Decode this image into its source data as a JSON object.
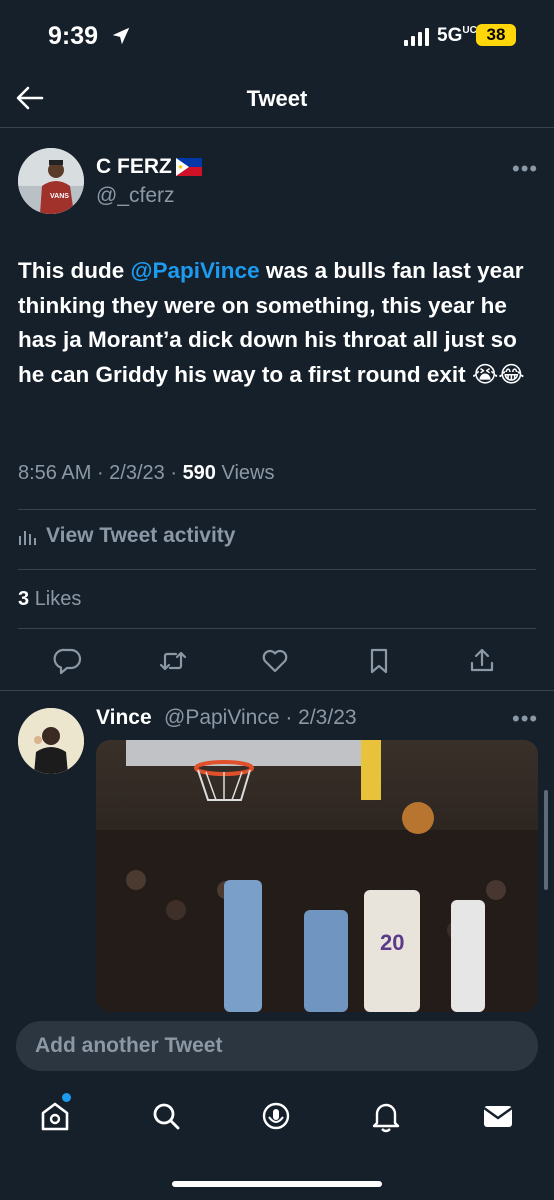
{
  "status_bar": {
    "time": "9:39",
    "network": "5G",
    "network_sup": "UC",
    "battery": "38"
  },
  "header": {
    "title": "Tweet"
  },
  "tweet": {
    "author_name": "C FERZ",
    "author_handle": "@_cferz",
    "text_before": "This dude ",
    "mention": "@PapiVince",
    "text_after": " was a bulls fan last year thinking they were on something, this year he has ja Morant’a dick down his throat all just so he can Griddy his way to a first round exit 😭😂",
    "time": "8:56 AM",
    "date": "2/3/23",
    "views_count": "590",
    "views_label": "Views",
    "activity_label": "View Tweet activity",
    "likes_count": "3",
    "likes_label": "Likes"
  },
  "reply": {
    "author_name": "Vince",
    "author_handle": "@PapiVince",
    "date": "2/3/23",
    "jersey_number": "20"
  },
  "compose": {
    "placeholder": "Add another Tweet"
  },
  "colors": {
    "background": "#15202b",
    "accent": "#1d9bf0",
    "muted": "#8b98a5",
    "divider": "#38444d",
    "battery": "#ffd60a"
  },
  "icons": [
    "location-arrow-icon",
    "signal-icon",
    "back-arrow-icon",
    "philippines-flag-icon",
    "more-icon",
    "activity-chart-icon",
    "reply-icon",
    "retweet-icon",
    "like-icon",
    "bookmark-icon",
    "share-icon",
    "home-icon",
    "search-icon",
    "spaces-icon",
    "notifications-icon",
    "messages-icon"
  ]
}
